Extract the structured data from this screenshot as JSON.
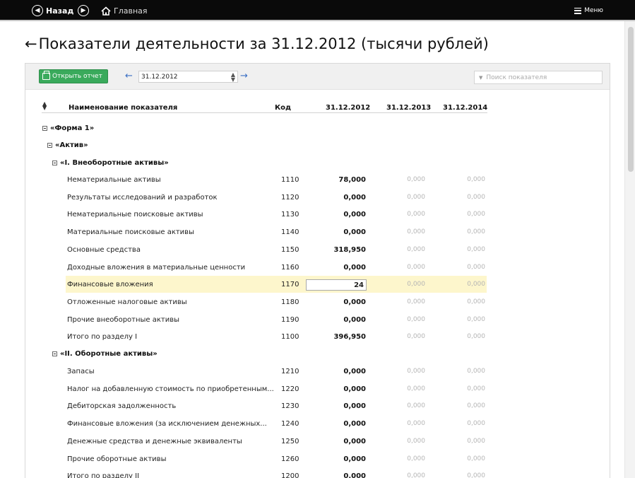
{
  "topbar": {
    "back_label": "Назад",
    "home_label": "Главная",
    "menu_label": "Меню"
  },
  "page": {
    "title": "Показатели деятельности за 31.12.2012 (тысячи рублей)",
    "back_arrow": "←"
  },
  "toolbar": {
    "open_report_label": "Открыть отчет",
    "date_value": "31.12.2012",
    "prev_arrow": "←",
    "next_arrow": "→",
    "search_placeholder": "Поиск показателя"
  },
  "table": {
    "headers": {
      "name": "Наименование показателя",
      "code": "Код",
      "col1": "31.12.2012",
      "col2": "31.12.2013",
      "col3": "31.12.2014"
    },
    "groups": {
      "form1": "«Форма 1»",
      "active": "«Актив»",
      "section1": "«I. Внеоборотные активы»",
      "section2": "«II. Оборотные активы»"
    },
    "rows1": [
      {
        "name": "Нематериальные активы",
        "code": "1110",
        "v1": "78,000",
        "v2": "0,000",
        "v3": "0,000"
      },
      {
        "name": "Результаты исследований и разработок",
        "code": "1120",
        "v1": "0,000",
        "v2": "0,000",
        "v3": "0,000"
      },
      {
        "name": "Нематериальные поисковые активы",
        "code": "1130",
        "v1": "0,000",
        "v2": "0,000",
        "v3": "0,000"
      },
      {
        "name": "Материальные поисковые активы",
        "code": "1140",
        "v1": "0,000",
        "v2": "0,000",
        "v3": "0,000"
      },
      {
        "name": "Основные средства",
        "code": "1150",
        "v1": "318,950",
        "v2": "0,000",
        "v3": "0,000"
      },
      {
        "name": "Доходные вложения в материальные ценности",
        "code": "1160",
        "v1": "0,000",
        "v2": "0,000",
        "v3": "0,000"
      },
      {
        "name": "Финансовые вложения",
        "code": "1170",
        "v1": "24",
        "v2": "0,000",
        "v3": "0,000"
      },
      {
        "name": "Отложенные налоговые активы",
        "code": "1180",
        "v1": "0,000",
        "v2": "0,000",
        "v3": "0,000"
      },
      {
        "name": "Прочие внеоборотные активы",
        "code": "1190",
        "v1": "0,000",
        "v2": "0,000",
        "v3": "0,000"
      },
      {
        "name": "Итого по разделу I",
        "code": "1100",
        "v1": "396,950",
        "v2": "0,000",
        "v3": "0,000"
      }
    ],
    "rows2": [
      {
        "name": "Запасы",
        "code": "1210",
        "v1": "0,000",
        "v2": "0,000",
        "v3": "0,000"
      },
      {
        "name": "Налог на добавленную стоимость по приобретенным...",
        "code": "1220",
        "v1": "0,000",
        "v2": "0,000",
        "v3": "0,000"
      },
      {
        "name": "Дебиторская задолженность",
        "code": "1230",
        "v1": "0,000",
        "v2": "0,000",
        "v3": "0,000"
      },
      {
        "name": "Финансовые вложения (за исключением денежных...",
        "code": "1240",
        "v1": "0,000",
        "v2": "0,000",
        "v3": "0,000"
      },
      {
        "name": "Денежные средства и денежные эквиваленты",
        "code": "1250",
        "v1": "0,000",
        "v2": "0,000",
        "v3": "0,000"
      },
      {
        "name": "Прочие оборотные активы",
        "code": "1260",
        "v1": "0,000",
        "v2": "0,000",
        "v3": "0,000"
      },
      {
        "name": "Итого по разделу II",
        "code": "1200",
        "v1": "0,000",
        "v2": "0,000",
        "v3": "0,000"
      }
    ]
  }
}
